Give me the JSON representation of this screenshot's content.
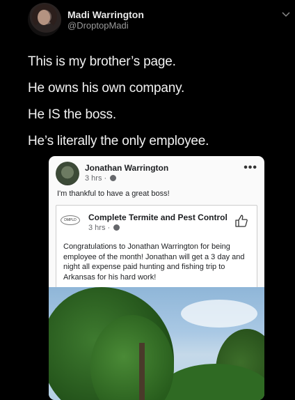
{
  "tweet": {
    "display_name": "Madi Warrington",
    "handle": "@DroptopMadi",
    "lines": [
      "This is my brother’s page.",
      "He owns his own company.",
      "He IS the boss.",
      "He’s literally the only employee."
    ]
  },
  "fb_post": {
    "author": "Jonathan Warrington",
    "time": "3 hrs ·",
    "more": "•••",
    "text": "I'm thankful to have a great boss!",
    "shared": {
      "logo_text": "DMPLD",
      "author": "Complete Termite and Pest Control",
      "time": "3 hrs ·",
      "text": "Congratulations to Jonathan Warrington for being employee of the month! Jonathan will get a 3 day and night all expense paid hunting and fishing trip to Arkansas for his hard work!"
    }
  },
  "icons": {
    "chevron": "chevron-down-icon",
    "globe": "globe-icon",
    "like": "thumbs-up-icon"
  },
  "colors": {
    "background": "#000000",
    "card": "#fafafa",
    "secondary_text": "#65676b"
  }
}
